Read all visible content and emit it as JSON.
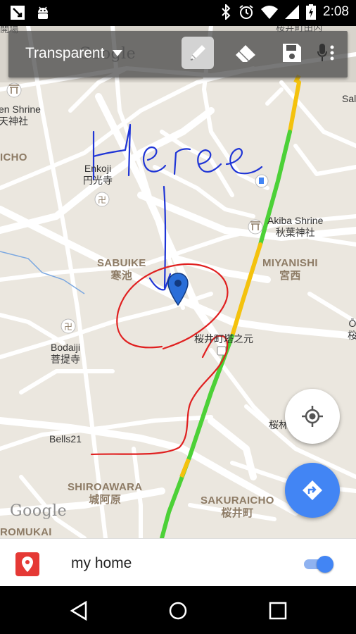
{
  "status_bar": {
    "time": "2:08"
  },
  "toolbar": {
    "mode_label": "Transparent",
    "icons": [
      "chevron-down-icon",
      "pen-icon",
      "eraser-icon",
      "save-icon",
      "mic-icon",
      "more-vert-icon"
    ]
  },
  "map": {
    "google_logo": "Google",
    "pois": {
      "shrine_west": "en Shrine",
      "shrine_west_jp": "天神社",
      "enkoji": "Enkoji",
      "enkoji_jp": "円光寺",
      "bodaiji": "Bodaiji",
      "bodaiji_jp": "菩提寺",
      "akiba": "Akiba Shrine",
      "akiba_jp": "秋葉神社",
      "sal": "Sal",
      "bells21": "Bells21",
      "station": "桜井町塔之元",
      "station_east": "桜林",
      "o_label": "Ō",
      "o_jp": "桜"
    },
    "areas": {
      "icho": "ICHO",
      "sabuike": "SABUIKE",
      "sabuike_jp": "寒池",
      "miyanishi": "MIYANISHI",
      "miyanishi_jp": "宮西",
      "shiroawara": "SHIROAWARA",
      "shiroawara_jp": "城阿原",
      "sakuraicho": "SAKURAICHO",
      "sakuraicho_jp": "桜井町",
      "romukai": "ROMUKAI",
      "top_jp": "桜井町田内",
      "top_left_jp": "開場"
    }
  },
  "bottom_bar": {
    "place_name": "my home",
    "toggle_on": true
  },
  "colors": {
    "accent": "#4285f4",
    "pin": "#e53935",
    "ink_red": "#e02020",
    "ink_blue": "#1f35d6",
    "traffic_green": "#4cd137",
    "traffic_yellow": "#f4c20d"
  }
}
